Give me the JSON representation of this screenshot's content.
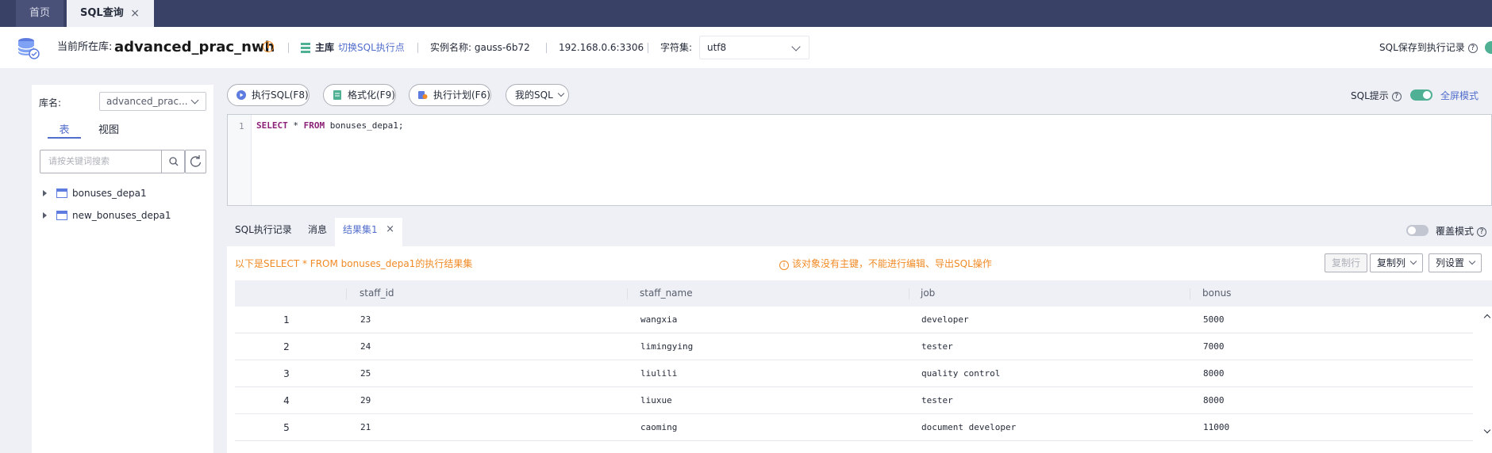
{
  "tabs": [
    {
      "label": "首页",
      "closable": false
    },
    {
      "label": "SQL查询",
      "closable": true,
      "close": "×"
    }
  ],
  "infobar": {
    "current_db_label": "当前所在库:",
    "db_name": "advanced_prac_nwh",
    "info_icon": "i",
    "main_label": "主库",
    "switch_label": "切换SQL执行点",
    "instance_label": "实例名称: gauss-6b72",
    "ip": "192.168.0.6:3306",
    "charset_label": "字符集:",
    "charset_value": "utf8",
    "save_label": "SQL保存到执行记录",
    "help": "?"
  },
  "sidebar": {
    "lib_label": "库名:",
    "lib_value": "advanced_prac...",
    "tabs": [
      "表",
      "视图"
    ],
    "search_placeholder": "请按关键词搜索",
    "tree": [
      "bonuses_depa1",
      "new_bonuses_depa1"
    ]
  },
  "toolbar": {
    "execute": "执行SQL(F8)",
    "format": "格式化(F9)",
    "plan": "执行计划(F6)",
    "my_sql": "我的SQL",
    "sql_tip": "SQL提示",
    "fullscreen": "全屏模式"
  },
  "editor": {
    "line_number": "1",
    "kw_select": "SELECT",
    "star": " * ",
    "kw_from": "FROM",
    "rest": " bonuses_depa1;"
  },
  "result_tabs": {
    "log": "SQL执行记录",
    "message": "消息",
    "result": "结果集1",
    "close": "×",
    "cover_mode": "覆盖模式"
  },
  "result": {
    "summary": "以下是SELECT * FROM bonuses_depa1的执行结果集",
    "warning": "该对象没有主键，不能进行编辑、导出SQL操作",
    "copy_row": "复制行",
    "copy_col": "复制列",
    "col_settings": "列设置",
    "columns": [
      "staff_id",
      "staff_name",
      "job",
      "bonus"
    ],
    "rows": [
      {
        "n": "1",
        "staff_id": "23",
        "staff_name": "wangxia",
        "job": "developer",
        "bonus": "5000"
      },
      {
        "n": "2",
        "staff_id": "24",
        "staff_name": "limingying",
        "job": "tester",
        "bonus": "7000"
      },
      {
        "n": "3",
        "staff_id": "25",
        "staff_name": "liulili",
        "job": "quality control",
        "bonus": "8000"
      },
      {
        "n": "4",
        "staff_id": "29",
        "staff_name": "liuxue",
        "job": "tester",
        "bonus": "8000"
      },
      {
        "n": "5",
        "staff_id": "21",
        "staff_name": "caoming",
        "job": "document developer",
        "bonus": "11000"
      }
    ]
  },
  "colors": {
    "tabbar": "#3a4166",
    "accent": "#526ecc",
    "warning": "#f08a24",
    "toggle_on": "#50b094"
  },
  "icons": [
    "database-logo-icon",
    "info-icon",
    "main-db-icon",
    "chevron-down-icon",
    "table-icon",
    "search-icon",
    "refresh-icon",
    "play-icon",
    "format-icon",
    "plan-icon",
    "help-icon",
    "fullscreen-icon",
    "close-icon",
    "warning-icon",
    "scroll-up-icon",
    "scroll-down-icon"
  ]
}
